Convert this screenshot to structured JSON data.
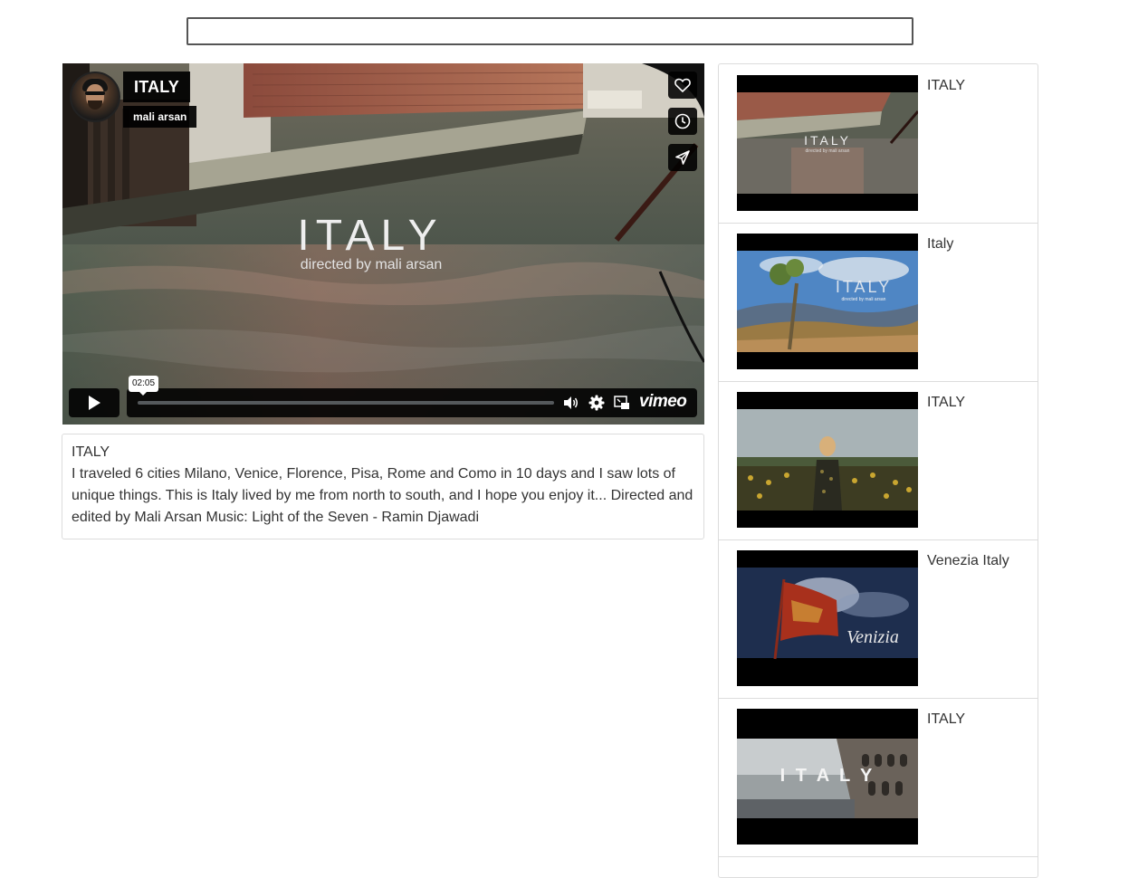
{
  "search": {
    "value": "",
    "placeholder": ""
  },
  "player": {
    "video_title": "ITALY",
    "author": "mali arsan",
    "overlay_title": "ITALY",
    "overlay_subtitle": "directed by mali arsan",
    "time_tooltip": "02:05",
    "progress": 0,
    "brand": "vimeo",
    "side_buttons": [
      "heart-icon",
      "clock-icon",
      "send-icon"
    ],
    "controls": [
      "play-icon",
      "volume-icon",
      "settings-icon",
      "pip-icon"
    ]
  },
  "description": {
    "title": "ITALY",
    "body": "I traveled 6 cities Milano, Venice, Florence, Pisa, Rome and Como in 10 days and I saw lots of unique things. This is Italy lived by me from north to south, and I hope you enjoy it... Directed and edited by Mali Arsan Music: Light of the Seven - Ramin Djawadi"
  },
  "related": [
    {
      "title": "ITALY",
      "thumb_text": "ITALY",
      "thumb_sub": "directed by mali arsan"
    },
    {
      "title": "Italy",
      "thumb_text": "ITALY",
      "thumb_sub": "directed by mali arsan"
    },
    {
      "title": "ITALY",
      "thumb_text": "",
      "thumb_sub": ""
    },
    {
      "title": "Venezia Italy",
      "thumb_text": "Venizia",
      "thumb_sub": ""
    },
    {
      "title": "ITALY",
      "thumb_text": "I T A L Y",
      "thumb_sub": ""
    }
  ],
  "colors": {
    "accent": "#00adef",
    "border": "#dcdcdc",
    "text": "#333333"
  }
}
